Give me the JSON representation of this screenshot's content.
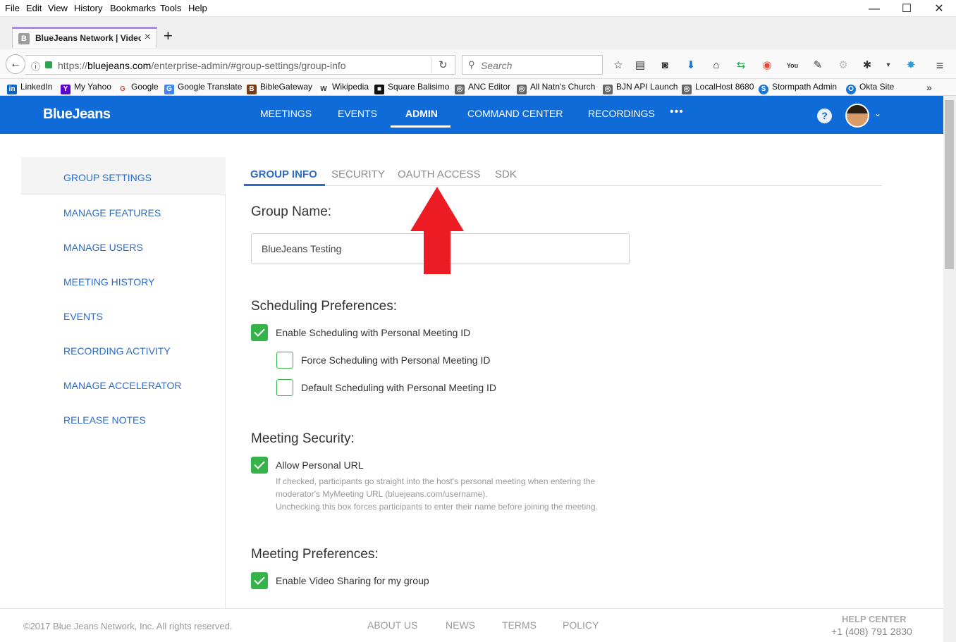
{
  "menubar": {
    "items": [
      "File",
      "Edit",
      "View",
      "History",
      "Bookmarks",
      "Tools",
      "Help"
    ]
  },
  "window": {
    "minimize": "—",
    "maximize": "☐",
    "close": "✕"
  },
  "tab": {
    "title": "BlueJeans Network | Video",
    "favicon": "B",
    "close": "×"
  },
  "newtab": "+",
  "navbar": {
    "url_prefix": "https://",
    "url_domain": "bluejeans.com",
    "url_path": "/enterprise-admin/#group-settings/group-info",
    "search_placeholder": "Search"
  },
  "bookmarks": [
    {
      "label": "LinkedIn",
      "icon": "in",
      "color": "#0a66c2"
    },
    {
      "label": "My Yahoo",
      "icon": "Y",
      "color": "#5f01d1"
    },
    {
      "label": "Google",
      "icon": "G",
      "color": "#db4437"
    },
    {
      "label": "Google Translate",
      "icon": "G",
      "color": "#4285f4"
    },
    {
      "label": "BibleGateway",
      "icon": "B",
      "color": "#7a3b12"
    },
    {
      "label": "Wikipedia",
      "icon": "W",
      "color": "#333"
    },
    {
      "label": "Square Balisimo",
      "icon": "■",
      "color": "#111"
    },
    {
      "label": "ANC Editor",
      "icon": "◎",
      "color": "#666"
    },
    {
      "label": "All Natn's Church",
      "icon": "◎",
      "color": "#666"
    },
    {
      "label": "BJN API Launch",
      "icon": "◎",
      "color": "#666"
    },
    {
      "label": "LocalHost 8680",
      "icon": "◎",
      "color": "#666"
    },
    {
      "label": "Stormpath Admin",
      "icon": "S",
      "color": "#1a74d6"
    },
    {
      "label": "Okta Site",
      "icon": "O",
      "color": "#1a74d6"
    }
  ],
  "app": {
    "logo": "BlueJeans",
    "nav": [
      "MEETINGS",
      "EVENTS",
      "ADMIN",
      "COMMAND CENTER",
      "RECORDINGS"
    ],
    "more": "•••",
    "help": "?",
    "chevron": "⌄"
  },
  "sidebar": {
    "items": [
      "GROUP SETTINGS",
      "MANAGE FEATURES",
      "MANAGE USERS",
      "MEETING HISTORY",
      "EVENTS",
      "RECORDING ACTIVITY",
      "MANAGE ACCELERATOR",
      "RELEASE NOTES"
    ]
  },
  "tabs": [
    "GROUP INFO",
    "SECURITY",
    "OAUTH ACCESS",
    "SDK"
  ],
  "form": {
    "group_name_label": "Group Name:",
    "group_name_value": "BlueJeans Testing",
    "scheduling_heading": "Scheduling Preferences:",
    "scheduling": [
      {
        "label": "Enable Scheduling with Personal Meeting ID",
        "checked": true
      },
      {
        "label": "Force Scheduling with Personal Meeting ID",
        "checked": false
      },
      {
        "label": "Default Scheduling with Personal Meeting ID",
        "checked": false
      }
    ],
    "security_heading": "Meeting Security:",
    "allow_personal_url": {
      "label": "Allow Personal URL",
      "checked": true
    },
    "security_desc": [
      "If checked, participants go straight into the host's personal meeting when entering the",
      "moderator's MyMeeting URL (bluejeans.com/username).",
      "Unchecking this box forces participants to enter their name before joining the meeting."
    ],
    "preferences_heading": "Meeting Preferences:",
    "video_sharing": {
      "label": "Enable Video Sharing for my group",
      "checked": true
    }
  },
  "footer": {
    "copyright": "©2017 Blue Jeans Network, Inc. All rights reserved.",
    "links": [
      "ABOUT US",
      "NEWS",
      "TERMS",
      "POLICY"
    ],
    "help_center": "HELP CENTER",
    "phone": "+1 (408) 791 2830"
  },
  "annotation": {
    "arrow_color": "#ed1c24"
  }
}
